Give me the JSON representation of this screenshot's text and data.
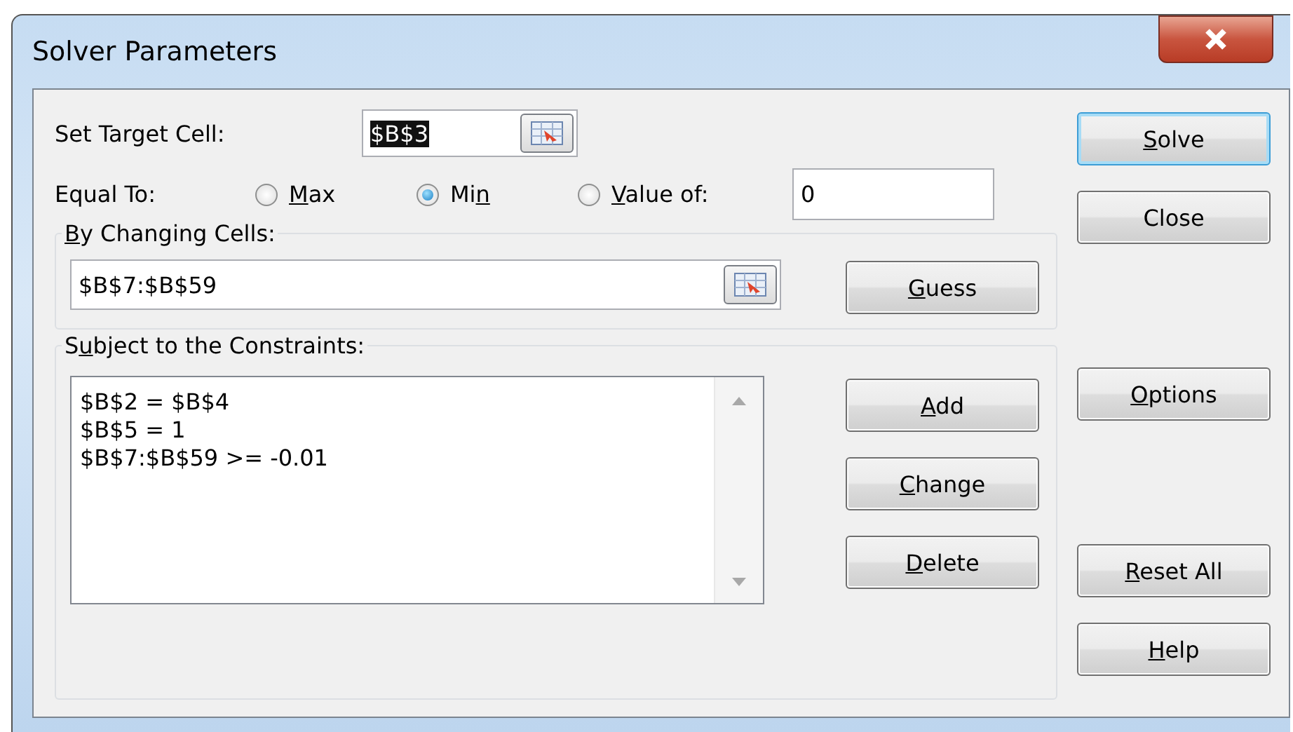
{
  "window": {
    "title": "Solver Parameters"
  },
  "target_cell": {
    "label": "Set Target Cell:",
    "value": "$B$3",
    "text_selected": true
  },
  "equal_to": {
    "label": "Equal To:",
    "options": [
      {
        "key": "M",
        "post": "ax",
        "selected": false
      },
      {
        "pre": "Mi",
        "key": "n",
        "selected": true
      },
      {
        "key": "V",
        "post": "alue of:",
        "selected": false
      }
    ],
    "value": "0"
  },
  "changing_cells": {
    "legend": {
      "key": "B",
      "post": "y Changing Cells:"
    },
    "value": "$B$7:$B$59",
    "button": {
      "key": "G",
      "post": "uess"
    }
  },
  "constraints": {
    "legend": {
      "pre": "S",
      "key": "u",
      "post": "bject to the Constraints:"
    },
    "items": [
      "$B$2 = $B$4",
      "$B$5 = 1",
      "$B$7:$B$59 >= -0.01"
    ],
    "buttons": [
      {
        "key": "A",
        "post": "dd"
      },
      {
        "key": "C",
        "post": "hange"
      },
      {
        "key": "D",
        "post": "elete"
      }
    ]
  },
  "side_buttons": [
    {
      "key": "S",
      "post": "olve",
      "default": true
    },
    {
      "pre": "Close",
      "default": false
    },
    {
      "key": "O",
      "post": "ptions",
      "default": false
    },
    {
      "key": "R",
      "post": "eset All",
      "default": false
    },
    {
      "key": "H",
      "post": "elp",
      "default": false
    }
  ]
}
